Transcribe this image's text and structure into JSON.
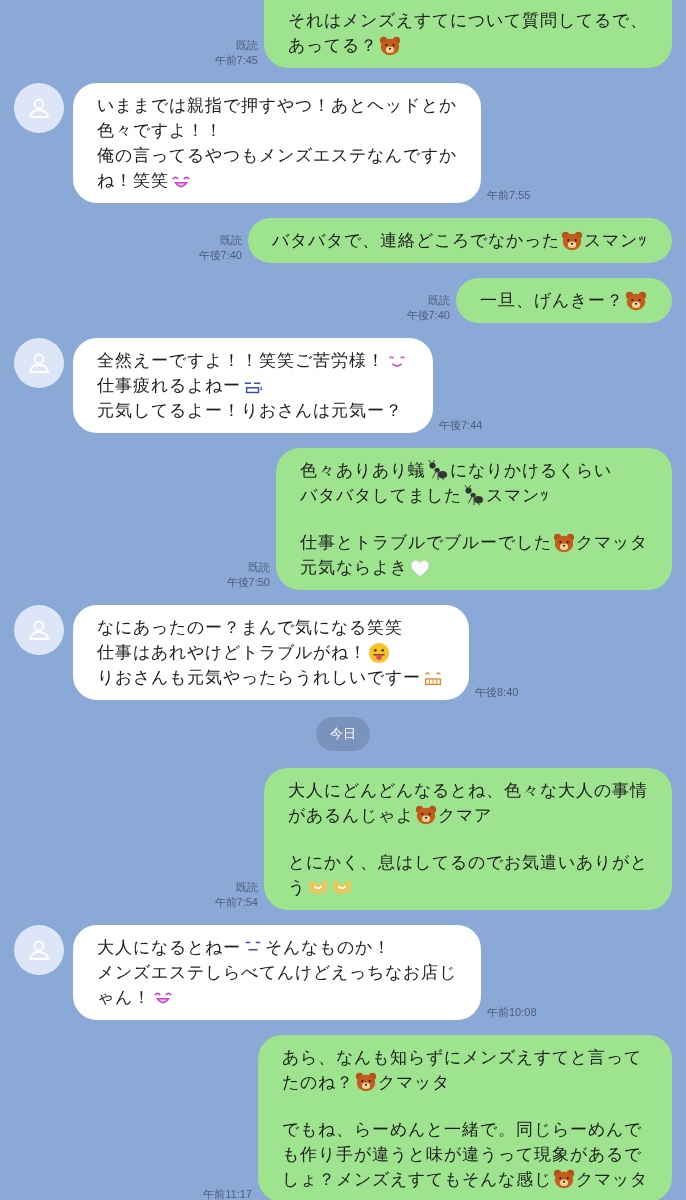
{
  "messages": [
    {
      "kind": "message",
      "outgoing": true,
      "read": "既読",
      "time": "午前7:45",
      "paragraphs": [
        [
          [
            {
              "kind": "text",
              "text": "それはメンズえすてについて質問してるで、"
            }
          ],
          [
            {
              "kind": "text",
              "text": "あってる？"
            },
            {
              "kind": "bear"
            }
          ]
        ]
      ]
    },
    {
      "kind": "message",
      "outgoing": false,
      "time": "午前7:55",
      "paragraphs": [
        [
          [
            {
              "kind": "text",
              "text": "いままでは親指で押すやつ！あとヘッドとか"
            }
          ],
          [
            {
              "kind": "text",
              "text": "色々ですよ！！"
            }
          ],
          [
            {
              "kind": "text",
              "text": "俺の言ってるやつもメンズエステなんですか"
            }
          ],
          [
            {
              "kind": "text",
              "text": "ね！笑笑"
            },
            {
              "kind": "laugh"
            }
          ]
        ]
      ]
    },
    {
      "kind": "message",
      "outgoing": true,
      "read": "既読",
      "time": "午後7:40",
      "paragraphs": [
        [
          [
            {
              "kind": "text",
              "text": "バタバタで、連絡どころでなかった"
            },
            {
              "kind": "bear"
            },
            {
              "kind": "text",
              "text": "スマンｯ"
            }
          ]
        ]
      ]
    },
    {
      "kind": "message",
      "outgoing": true,
      "read": "既読",
      "time": "午後7:40",
      "paragraphs": [
        [
          [
            {
              "kind": "text",
              "text": "一旦、げんきー？"
            },
            {
              "kind": "bear"
            }
          ]
        ]
      ]
    },
    {
      "kind": "message",
      "outgoing": false,
      "time": "午後7:44",
      "paragraphs": [
        [
          [
            {
              "kind": "text",
              "text": "全然えーですよ！！笑笑ご苦労様！"
            },
            {
              "kind": "smile"
            }
          ],
          [
            {
              "kind": "text",
              "text": "仕事疲れるよねー"
            },
            {
              "kind": "sweat"
            }
          ],
          [
            {
              "kind": "text",
              "text": "元気してるよー！りおさんは元気ー？"
            }
          ]
        ]
      ]
    },
    {
      "kind": "message",
      "outgoing": true,
      "read": "既読",
      "time": "午後7:50",
      "paragraphs": [
        [
          [
            {
              "kind": "text",
              "text": "色々ありあり蟻"
            },
            {
              "kind": "ant"
            },
            {
              "kind": "text",
              "text": "になりかけるくらい"
            }
          ],
          [
            {
              "kind": "text",
              "text": "バタバタしてました"
            },
            {
              "kind": "ant"
            },
            {
              "kind": "text",
              "text": "スマンｯ"
            }
          ]
        ],
        [
          [
            {
              "kind": "text",
              "text": "仕事とトラブルでブルーでした"
            },
            {
              "kind": "bear"
            },
            {
              "kind": "text",
              "text": "クマッタ"
            }
          ],
          [
            {
              "kind": "text",
              "text": "元気ならよき"
            },
            {
              "kind": "heart"
            }
          ]
        ]
      ]
    },
    {
      "kind": "message",
      "outgoing": false,
      "time": "午後8:40",
      "paragraphs": [
        [
          [
            {
              "kind": "text",
              "text": "なにあったのー？まんで気になる笑笑"
            }
          ],
          [
            {
              "kind": "text",
              "text": "仕事はあれやけどトラブルがね！"
            },
            {
              "kind": "tongue"
            }
          ],
          [
            {
              "kind": "text",
              "text": "りおさんも元気やったらうれしいですー"
            },
            {
              "kind": "grin"
            }
          ]
        ]
      ]
    },
    {
      "kind": "date",
      "label": "今日"
    },
    {
      "kind": "message",
      "outgoing": true,
      "read": "既読",
      "time": "午前7:54",
      "paragraphs": [
        [
          [
            {
              "kind": "text",
              "text": "大人にどんどんなるとね、色々な大人の事情"
            }
          ],
          [
            {
              "kind": "text",
              "text": "があるんじゃよ"
            },
            {
              "kind": "bear"
            },
            {
              "kind": "text",
              "text": "クマア"
            }
          ]
        ],
        [
          [
            {
              "kind": "text",
              "text": "とにかく、息はしてるのでお気遣いありがと"
            }
          ],
          [
            {
              "kind": "text",
              "text": "う"
            },
            {
              "kind": "hands"
            },
            {
              "kind": "hands"
            }
          ]
        ]
      ]
    },
    {
      "kind": "message",
      "outgoing": false,
      "time": "午前10:08",
      "paragraphs": [
        [
          [
            {
              "kind": "text",
              "text": "大人になるとねー"
            },
            {
              "kind": "hmm"
            },
            {
              "kind": "text",
              "text": "そんなものか！"
            }
          ],
          [
            {
              "kind": "text",
              "text": "メンズエステしらべてんけどえっちなお店じ"
            }
          ],
          [
            {
              "kind": "text",
              "text": "ゃん！"
            },
            {
              "kind": "laugh"
            }
          ]
        ]
      ]
    },
    {
      "kind": "message",
      "outgoing": true,
      "time": "午前11:17",
      "paragraphs": [
        [
          [
            {
              "kind": "text",
              "text": "あら、なんも知らずにメンズえすてと言って"
            }
          ],
          [
            {
              "kind": "text",
              "text": "たのね？"
            },
            {
              "kind": "bear"
            },
            {
              "kind": "text",
              "text": "クマッタ"
            }
          ]
        ],
        [
          [
            {
              "kind": "text",
              "text": "でもね、らーめんと一緒で。同じらーめんで"
            }
          ],
          [
            {
              "kind": "text",
              "text": "も作り手が違うと味が違うって現象があるで"
            }
          ],
          [
            {
              "kind": "text",
              "text": "しょ？メンズえすてもそんな感じ"
            },
            {
              "kind": "bear"
            },
            {
              "kind": "text",
              "text": "クマッタ"
            }
          ]
        ]
      ]
    }
  ]
}
